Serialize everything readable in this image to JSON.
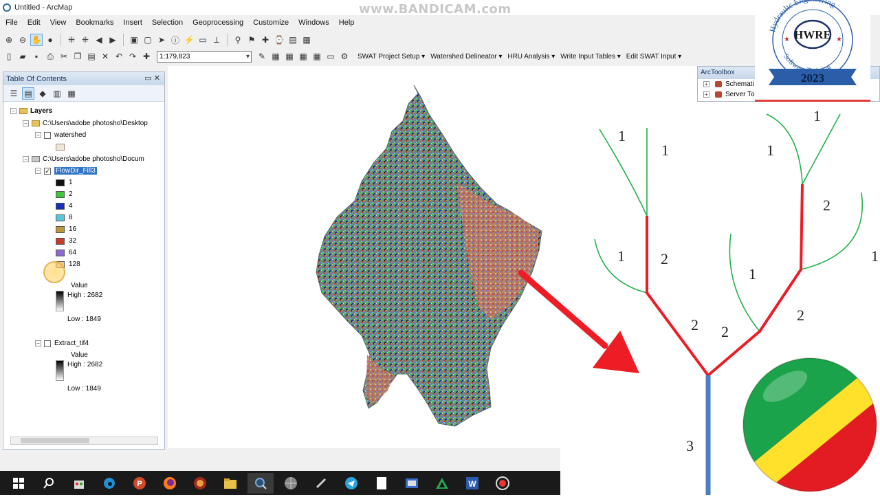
{
  "window": {
    "title": "Untitled - ArcMap"
  },
  "watermark": "www.BANDICAM.com",
  "menu": [
    "File",
    "Edit",
    "View",
    "Bookmarks",
    "Insert",
    "Selection",
    "Geoprocessing",
    "Customize",
    "Windows",
    "Help"
  ],
  "toolbar": {
    "scale_value": "1:179,823",
    "swat_menus": [
      "SWAT Project Setup ▾",
      "Watershed Delineator ▾",
      "HRU Analysis ▾",
      "Write Input Tables ▾",
      "Edit SWAT Input ▾"
    ]
  },
  "toc": {
    "title": "Table Of Contents",
    "root": "Layers",
    "group1_path": "C:\\Users\\adobe photosho\\Desktop",
    "layer_watershed": "watershed",
    "group2_path": "C:\\Users\\adobe photosho\\Docum",
    "layer_flowdir": "FlowDir_Fill3",
    "flowdir_classes": [
      {
        "label": "1",
        "color": "#111111"
      },
      {
        "label": "2",
        "color": "#3cc43c"
      },
      {
        "label": "4",
        "color": "#1a2fb8"
      },
      {
        "label": "8",
        "color": "#58c8d8"
      },
      {
        "label": "16",
        "color": "#b89a3a"
      },
      {
        "label": "32",
        "color": "#c83a2a"
      },
      {
        "label": "64",
        "color": "#8a6ad0"
      },
      {
        "label": "128",
        "color": "#e8c890"
      }
    ],
    "value_label": "Value",
    "high1": "High : 2682",
    "low1": "Low : 1849",
    "layer_extract": "Extract_tif4",
    "value_label2": "Value",
    "high2": "High : 2682",
    "low2": "Low : 1849"
  },
  "arctoolbox": {
    "title": "ArcToolbox",
    "items": [
      "Schemati",
      "Server To"
    ]
  },
  "logo": {
    "arc_text": "Hydraulic Engineering",
    "center": "HWRE",
    "bottom_arc": "Software Training",
    "year": "2023"
  },
  "stream_order": {
    "labels": [
      "1",
      "1",
      "1",
      "1",
      "2",
      "1",
      "2",
      "2",
      "2",
      "1",
      "2",
      "1",
      "3",
      "1"
    ]
  },
  "colors": {
    "order1": "#22b14c",
    "order2": "#ee1c24",
    "order3": "#4a7ec0",
    "arrow": "#ee1c24"
  }
}
